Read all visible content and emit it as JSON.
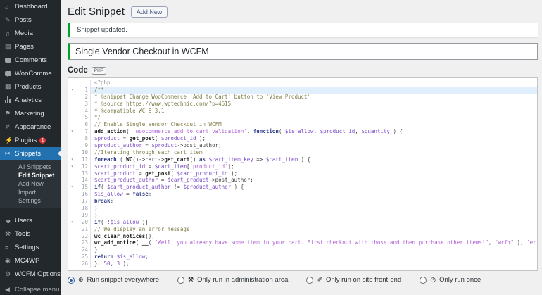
{
  "colors": {
    "accent": "#2271b1",
    "success": "#00a32a",
    "badge": "#d63638",
    "sidebar_bg": "#23282d"
  },
  "sidebar": {
    "top": [
      {
        "name": "dashboard",
        "icon": "dashboard-icon",
        "glyph": "⌂",
        "label": "Dashboard"
      },
      {
        "name": "posts",
        "icon": "pushpin-icon",
        "glyph": "✎",
        "label": "Posts"
      },
      {
        "name": "media",
        "icon": "media-note-icon",
        "glyph": "♫",
        "label": "Media"
      },
      {
        "name": "pages",
        "icon": "pages-icon",
        "glyph": "▤",
        "label": "Pages"
      },
      {
        "name": "comments",
        "icon": "comment-bubble-icon",
        "shape": "bubble",
        "label": "Comments"
      },
      {
        "name": "woocommerce",
        "icon": "woocommerce-bubble-icon",
        "shape": "bubble",
        "label": "WooCommerce"
      },
      {
        "name": "products",
        "icon": "products-box-icon",
        "glyph": "▦",
        "label": "Products"
      },
      {
        "name": "analytics",
        "icon": "analytics-bars-icon",
        "shape": "bars",
        "label": "Analytics"
      },
      {
        "name": "marketing",
        "icon": "megaphone-icon",
        "glyph": "⚑",
        "label": "Marketing"
      },
      {
        "name": "appearance",
        "icon": "brush-icon",
        "glyph": "✐",
        "label": "Appearance"
      },
      {
        "name": "plugins",
        "icon": "plugin-icon",
        "glyph": "⚡",
        "label": "Plugins",
        "badge": "1"
      },
      {
        "name": "snippets",
        "icon": "scissors-icon",
        "glyph": "✂",
        "label": "Snippets",
        "active": true,
        "submenu": [
          {
            "name": "all-snippets",
            "label": "All Snippets"
          },
          {
            "name": "edit-snippet",
            "label": "Edit Snippet",
            "current": true
          },
          {
            "name": "add-new",
            "label": "Add New"
          },
          {
            "name": "import",
            "label": "Import"
          },
          {
            "name": "settings",
            "label": "Settings"
          }
        ]
      },
      {
        "name": "users",
        "icon": "user-icon",
        "glyph": "☻",
        "label": "Users",
        "group_gap": true
      },
      {
        "name": "tools",
        "icon": "tools-icon",
        "glyph": "⚒",
        "label": "Tools"
      },
      {
        "name": "settings",
        "icon": "settings-icon",
        "glyph": "≡",
        "label": "Settings"
      },
      {
        "name": "mc4wp",
        "icon": "mc4wp-logo-icon",
        "glyph": "◉",
        "label": "MC4WP"
      },
      {
        "name": "wcfm-options",
        "icon": "gear-icon",
        "glyph": "⚙",
        "label": "WCFM Options"
      },
      {
        "name": "collapse-menu",
        "icon": "collapse-arrow-icon",
        "glyph": "◀",
        "label": "Collapse menu",
        "collapse": true
      }
    ]
  },
  "header": {
    "title": "Edit Snippet",
    "add_new_label": "Add New"
  },
  "notice": {
    "text": "Snippet updated."
  },
  "snippet": {
    "title": "Single Vendor Checkout in WCFM"
  },
  "code_section": {
    "label": "Code",
    "badge": "PHP"
  },
  "editor": {
    "meta_line": "<?php",
    "active_line": 1,
    "fold_lines": [
      1,
      7,
      11,
      12,
      15,
      20
    ],
    "lines": [
      {
        "n": 1,
        "t": [
          [
            "/**",
            "c"
          ]
        ]
      },
      {
        "n": 2,
        "t": [
          [
            "* @snippet Change WooCommerce 'Add to Cart' button to 'View Product'",
            "c"
          ]
        ]
      },
      {
        "n": 3,
        "t": [
          [
            "* @source https://www.wptechnic.com/?p=4615",
            "c"
          ]
        ]
      },
      {
        "n": 4,
        "t": [
          [
            "* @compatible WC 6.3.1",
            "c"
          ]
        ]
      },
      {
        "n": 5,
        "t": [
          [
            "*/",
            "c"
          ]
        ]
      },
      {
        "n": 6,
        "t": [
          [
            "// Enable Single Vendor Checkout in WCFM",
            "c"
          ]
        ]
      },
      {
        "n": 7,
        "t": [
          [
            "add_action",
            "f"
          ],
          [
            "( ",
            "p"
          ],
          [
            "'woocommerce_add_to_cart_validation'",
            "s"
          ],
          [
            ", ",
            "p"
          ],
          [
            "function",
            "k"
          ],
          [
            "( ",
            "p"
          ],
          [
            "$is_allow",
            "v"
          ],
          [
            ", ",
            "p"
          ],
          [
            "$product_id",
            "v"
          ],
          [
            ", ",
            "p"
          ],
          [
            "$quantity",
            "v"
          ],
          [
            " ) {",
            "p"
          ]
        ]
      },
      {
        "n": 8,
        "t": [
          [
            "$product",
            "v"
          ],
          [
            " = ",
            "p"
          ],
          [
            "get_post",
            "f"
          ],
          [
            "( ",
            "p"
          ],
          [
            "$product_id",
            "v"
          ],
          [
            " );",
            "p"
          ]
        ]
      },
      {
        "n": 9,
        "t": [
          [
            "$product_author",
            "v"
          ],
          [
            " = ",
            "p"
          ],
          [
            "$product",
            "v"
          ],
          [
            "->post_author;",
            "p"
          ]
        ]
      },
      {
        "n": 10,
        "t": [
          [
            "//Iterating through each cart item",
            "c"
          ]
        ]
      },
      {
        "n": 11,
        "t": [
          [
            "foreach",
            "k"
          ],
          [
            " ( ",
            "p"
          ],
          [
            "WC",
            "f"
          ],
          [
            "()->cart->",
            "p"
          ],
          [
            "get_cart",
            "f"
          ],
          [
            "() ",
            "p"
          ],
          [
            "as",
            "k"
          ],
          [
            " ",
            "p"
          ],
          [
            "$cart_item_key",
            "v"
          ],
          [
            " => ",
            "p"
          ],
          [
            "$cart_item",
            "v"
          ],
          [
            " ) {",
            "p"
          ]
        ]
      },
      {
        "n": 12,
        "t": [
          [
            "$cart_product_id",
            "v"
          ],
          [
            " = ",
            "p"
          ],
          [
            "$cart_item",
            "v"
          ],
          [
            "[",
            "p"
          ],
          [
            "'product_id'",
            "s"
          ],
          [
            "];",
            "p"
          ]
        ]
      },
      {
        "n": 13,
        "t": [
          [
            "$cart_product",
            "v"
          ],
          [
            " = ",
            "p"
          ],
          [
            "get_post",
            "f"
          ],
          [
            "( ",
            "p"
          ],
          [
            "$cart_product_id",
            "v"
          ],
          [
            " );",
            "p"
          ]
        ]
      },
      {
        "n": 14,
        "t": [
          [
            "$cart_product_author",
            "v"
          ],
          [
            " = ",
            "p"
          ],
          [
            "$cart_product",
            "v"
          ],
          [
            "->post_author;",
            "p"
          ]
        ]
      },
      {
        "n": 15,
        "t": [
          [
            "if",
            "k"
          ],
          [
            "( ",
            "p"
          ],
          [
            "$cart_product_author",
            "v"
          ],
          [
            " != ",
            "p"
          ],
          [
            "$product_author",
            "v"
          ],
          [
            " ) {",
            "p"
          ]
        ]
      },
      {
        "n": 16,
        "t": [
          [
            "$is_allow",
            "v"
          ],
          [
            " = ",
            "p"
          ],
          [
            "false",
            "k"
          ],
          [
            ";",
            "p"
          ]
        ]
      },
      {
        "n": 17,
        "t": [
          [
            "break",
            "k"
          ],
          [
            ";",
            "p"
          ]
        ]
      },
      {
        "n": 18,
        "t": [
          [
            "}",
            "p"
          ]
        ]
      },
      {
        "n": 19,
        "t": [
          [
            "}",
            "p"
          ]
        ]
      },
      {
        "n": 20,
        "t": [
          [
            "if",
            "k"
          ],
          [
            "( !",
            "p"
          ],
          [
            "$is_allow",
            "v"
          ],
          [
            " ){",
            "p"
          ]
        ]
      },
      {
        "n": 21,
        "t": [
          [
            "// We display an error message",
            "c"
          ]
        ]
      },
      {
        "n": 22,
        "t": [
          [
            "wc_clear_notices",
            "f"
          ],
          [
            "();",
            "p"
          ]
        ]
      },
      {
        "n": 23,
        "t": [
          [
            "wc_add_notice",
            "f"
          ],
          [
            "( ",
            "p"
          ],
          [
            "__",
            "f"
          ],
          [
            "( ",
            "p"
          ],
          [
            "\"Well, you already have some item in your cart. First checkout with those and then purchase other items!\"",
            "s"
          ],
          [
            ", ",
            "p"
          ],
          [
            "\"wcfm\"",
            "s"
          ],
          [
            " ), ",
            "p"
          ],
          [
            "'error'",
            "s"
          ],
          [
            " );",
            "p"
          ]
        ]
      },
      {
        "n": 24,
        "t": [
          [
            "}",
            "p"
          ]
        ]
      },
      {
        "n": 25,
        "t": [
          [
            "return",
            "k"
          ],
          [
            " ",
            "p"
          ],
          [
            "$is_allow",
            "v"
          ],
          [
            ";",
            "p"
          ]
        ]
      },
      {
        "n": 26,
        "t": [
          [
            "}, ",
            "p"
          ],
          [
            "50",
            "n"
          ],
          [
            ", ",
            "p"
          ],
          [
            "3",
            "n"
          ],
          [
            " );",
            "p"
          ]
        ]
      }
    ]
  },
  "footer": {
    "options": [
      {
        "name": "run-everywhere",
        "label": "Run snippet everywhere",
        "icon": "globe-icon",
        "glyph": "⊕",
        "selected": true
      },
      {
        "name": "run-admin-only",
        "label": "Only run in administration area",
        "icon": "wrench-icon",
        "glyph": "⚒",
        "selected": false
      },
      {
        "name": "run-frontend-only",
        "label": "Only run on site front-end",
        "icon": "brush-icon",
        "glyph": "✐",
        "selected": false
      },
      {
        "name": "run-once",
        "label": "Only run once",
        "icon": "clock-icon",
        "glyph": "◷",
        "selected": false
      }
    ]
  }
}
